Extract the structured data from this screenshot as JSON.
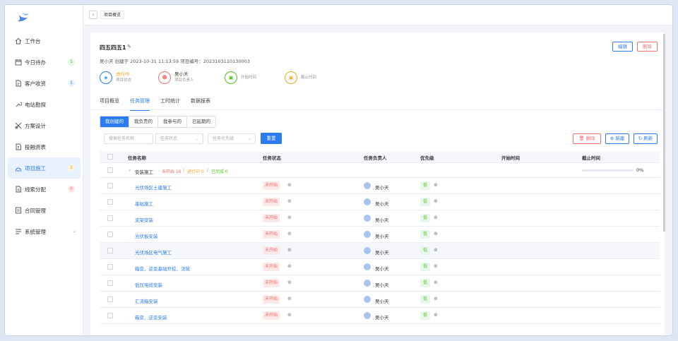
{
  "topbar": {
    "back_icon": "chevron-left-icon",
    "breadcrumb": "项目概览"
  },
  "sidebar": {
    "items": [
      {
        "label": "工作台",
        "icon": "home-icon",
        "badge": ""
      },
      {
        "label": "今日待办",
        "icon": "calendar-icon",
        "badge": "1"
      },
      {
        "label": "客户收资",
        "icon": "doc-icon",
        "badge": "1"
      },
      {
        "label": "电站勘探",
        "icon": "tool-icon",
        "badge": ""
      },
      {
        "label": "方案设计",
        "icon": "design-icon",
        "badge": ""
      },
      {
        "label": "投融资表",
        "icon": "finance-icon",
        "badge": ""
      },
      {
        "label": "项目施工",
        "icon": "construction-icon",
        "badge": "2"
      },
      {
        "label": "线索分配",
        "icon": "assign-icon",
        "badge": "0"
      },
      {
        "label": "合同管理",
        "icon": "contract-icon",
        "badge": ""
      },
      {
        "label": "系统管理",
        "icon": "settings-icon",
        "badge": ""
      }
    ]
  },
  "project": {
    "title": "四五四五1",
    "meta": "吴小天  创建于 2023-10-31 11:13:59     项目编号：2023103110130003",
    "edit_label": "编辑",
    "delete_label": "删除",
    "stats": [
      {
        "value": "进行中",
        "label": "项目状态"
      },
      {
        "value": "吴小天",
        "label": "项目负责人"
      },
      {
        "value": "",
        "label": "开始时间"
      },
      {
        "value": "",
        "label": "截止时间"
      }
    ]
  },
  "tabs": [
    "项目概览",
    "任务管理",
    "工时统计",
    "数据报表"
  ],
  "segments": [
    "我创建的",
    "我负责的",
    "我参与的",
    "已延期的"
  ],
  "filters": {
    "name_placeholder": "搜索任务名称",
    "status_placeholder": "任务状态",
    "priority_placeholder": "任务优先级",
    "reset_label": "重置"
  },
  "actions": {
    "delete": "删除",
    "new": "新建",
    "refresh": "刷新"
  },
  "table": {
    "headers": [
      "任务名称",
      "任务状态",
      "任务负责人",
      "优先级",
      "开始时间",
      "截止时间"
    ],
    "group": {
      "name": "安装施工",
      "pending": "未开始 16",
      "sep1": "/",
      "in_progress": "进行中 0",
      "sep2": "/",
      "done": "已完成 0",
      "progress": "0%",
      "progress_value": 0
    },
    "rows": [
      {
        "name": "光伏场区土建施工",
        "status": "未开始",
        "owner": "吴小天",
        "priority": "低"
      },
      {
        "name": "基础施工",
        "status": "未开始",
        "owner": "吴小天",
        "priority": "低"
      },
      {
        "name": "支架安装",
        "status": "未开始",
        "owner": "吴小天",
        "priority": "低"
      },
      {
        "name": "光伏板安装",
        "status": "未开始",
        "owner": "吴小天",
        "priority": "低"
      },
      {
        "name": "光伏场区电气施工",
        "status": "未开始",
        "owner": "吴小天",
        "priority": "低"
      },
      {
        "name": "箱变、逆变基础开挖、浇筑",
        "status": "未开始",
        "owner": "吴小天",
        "priority": "低"
      },
      {
        "name": "低压电缆安装",
        "status": "未开始",
        "owner": "吴小天",
        "priority": "低"
      },
      {
        "name": "汇流箱安装",
        "status": "未开始",
        "owner": "吴小天",
        "priority": "低"
      },
      {
        "name": "箱变、逆变安装",
        "status": "未开始",
        "owner": "吴小天",
        "priority": "低"
      }
    ]
  },
  "colors": {
    "accent": "#2b7bf3",
    "danger": "#f0736f",
    "success": "#52c41a",
    "warning": "#f5a623"
  }
}
